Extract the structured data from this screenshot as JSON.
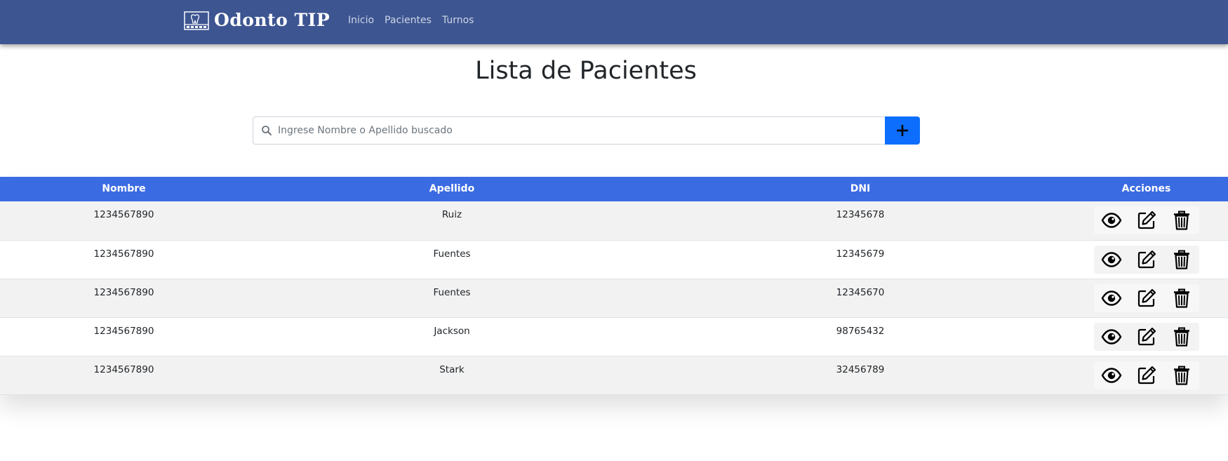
{
  "nav": {
    "brand": "Odonto TIP",
    "links": [
      "Inicio",
      "Pacientes",
      "Turnos"
    ]
  },
  "page": {
    "title": "Lista de Pacientes"
  },
  "search": {
    "placeholder": "Ingrese Nombre o Apellido buscado",
    "value": ""
  },
  "table": {
    "headers": [
      "Nombre",
      "Apellido",
      "DNI",
      "Acciones"
    ],
    "rows": [
      {
        "nombre": "1234567890",
        "apellido": "Ruiz",
        "dni": "12345678"
      },
      {
        "nombre": "1234567890",
        "apellido": "Fuentes",
        "dni": "12345679"
      },
      {
        "nombre": "1234567890",
        "apellido": "Fuentes",
        "dni": "12345670"
      },
      {
        "nombre": "1234567890",
        "apellido": "Jackson",
        "dni": "98765432"
      },
      {
        "nombre": "1234567890",
        "apellido": "Stark",
        "dni": "32456789"
      }
    ],
    "actions": [
      "eye-icon",
      "edit-icon",
      "trash-icon"
    ]
  },
  "colors": {
    "navbar": "#3d5591",
    "table_header": "#3b6be3",
    "add_button": "#0d6efd"
  }
}
